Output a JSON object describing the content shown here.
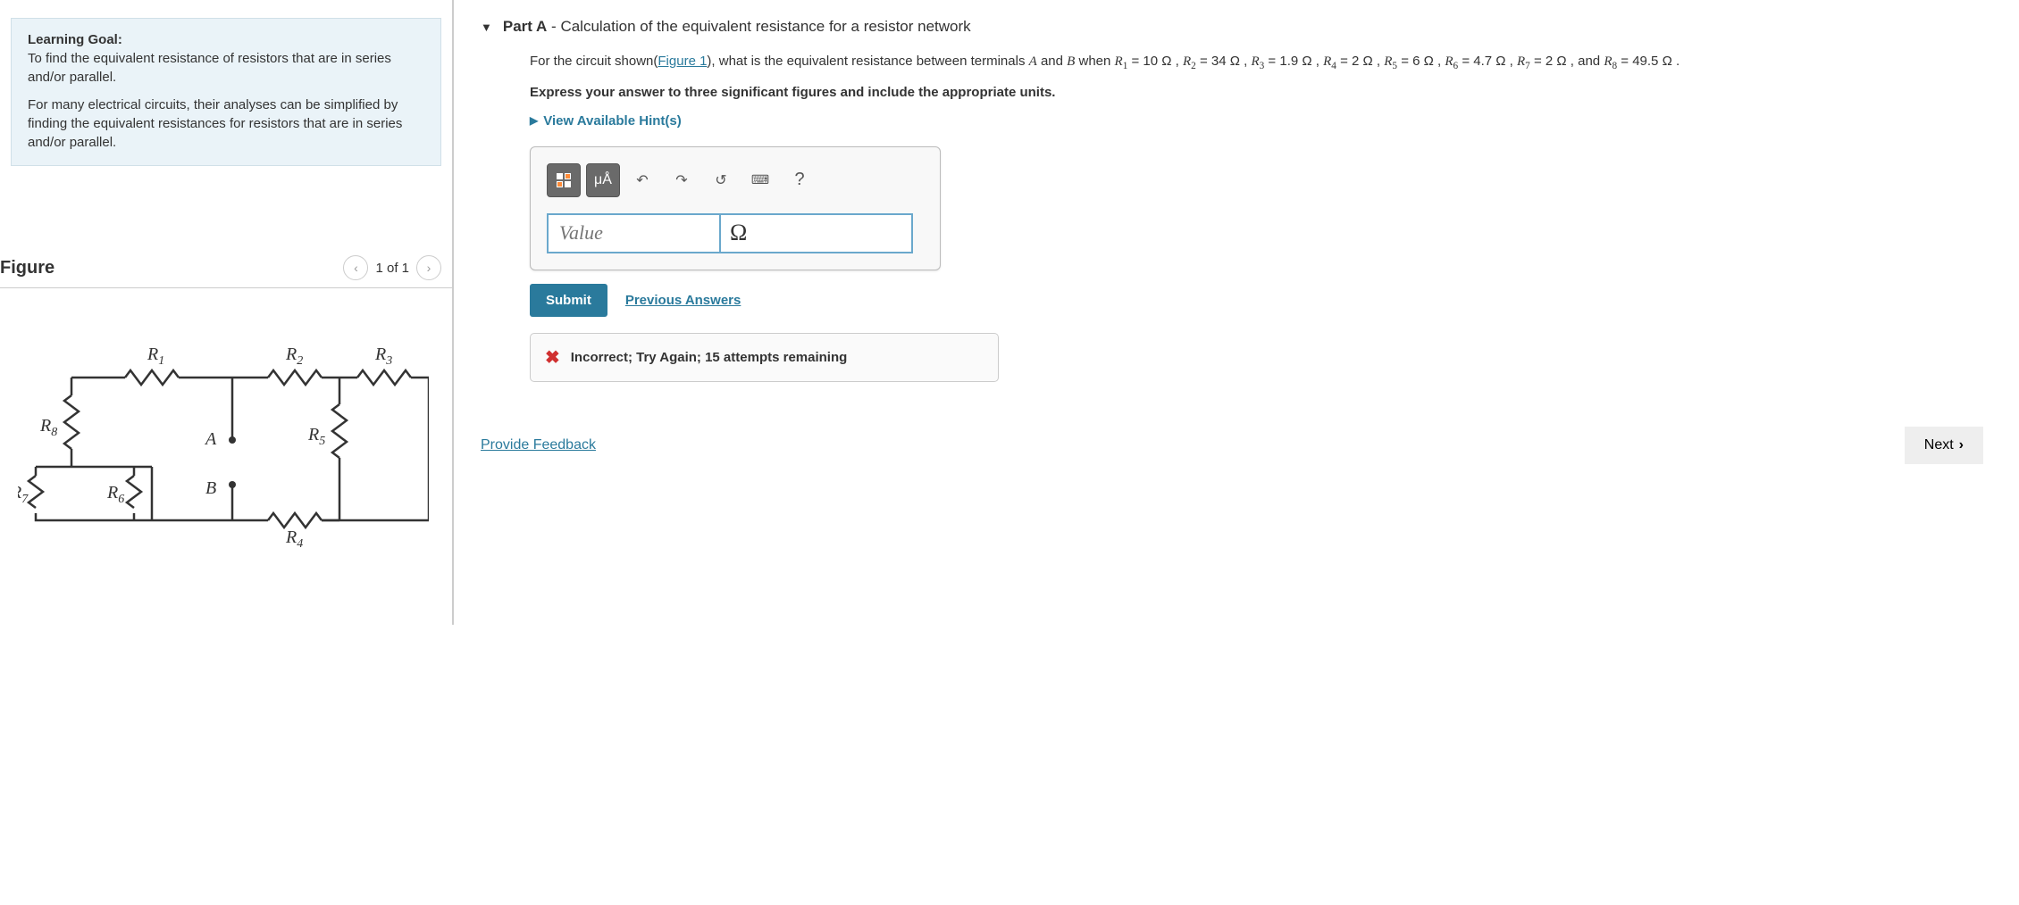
{
  "left": {
    "goal_heading": "Learning Goal:",
    "goal_text": "To find the equivalent resistance of resistors that are in series and/or parallel.",
    "description": "For many electrical circuits, their analyses can be simplified by finding the equivalent resistances for resistors that are in series and/or parallel.",
    "figure_heading": "Figure",
    "figure_counter": "1 of 1"
  },
  "part": {
    "label": "Part A",
    "title": "Calculation of the equivalent resistance for a resistor network"
  },
  "question": {
    "intro": "For the circuit shown(",
    "figure_link": "Figure 1",
    "after_link": "), what is the equivalent resistance between terminals ",
    "termA": "A",
    "and1": " and ",
    "termB": "B",
    "when": " when ",
    "r1_label": "R",
    "r1_sub": "1",
    "r1_eq": " = 10 Ω , ",
    "r2_label": "R",
    "r2_sub": "2",
    "r2_eq": " = 34 Ω , ",
    "r3_label": "R",
    "r3_sub": "3",
    "r3_eq": " = 1.9 Ω , ",
    "r4_label": "R",
    "r4_sub": "4",
    "r4_eq": " = 2 Ω , ",
    "r5_label": "R",
    "r5_sub": "5",
    "r5_eq": " = 6 Ω , ",
    "r6_label": "R",
    "r6_sub": "6",
    "r6_eq": " = 4.7 Ω , ",
    "r7_label": "R",
    "r7_sub": "7",
    "r7_eq": " = 2 Ω , and ",
    "r8_label": "R",
    "r8_sub": "8",
    "r8_eq": " = 49.5 Ω ."
  },
  "instruct": "Express your answer to three significant figures and include the appropriate units.",
  "hints_label": "View Available Hint(s)",
  "toolbar": {
    "special": "μÅ",
    "undo": "↶",
    "redo": "↷",
    "reset": "↺",
    "keyboard": "⌨",
    "help": "?"
  },
  "input": {
    "value_placeholder": "Value",
    "unit": "Ω"
  },
  "submit_label": "Submit",
  "prev_answers": "Previous Answers",
  "feedback_msg": "Incorrect; Try Again; 15 attempts remaining",
  "provide_feedback": "Provide Feedback",
  "next_label": "Next"
}
